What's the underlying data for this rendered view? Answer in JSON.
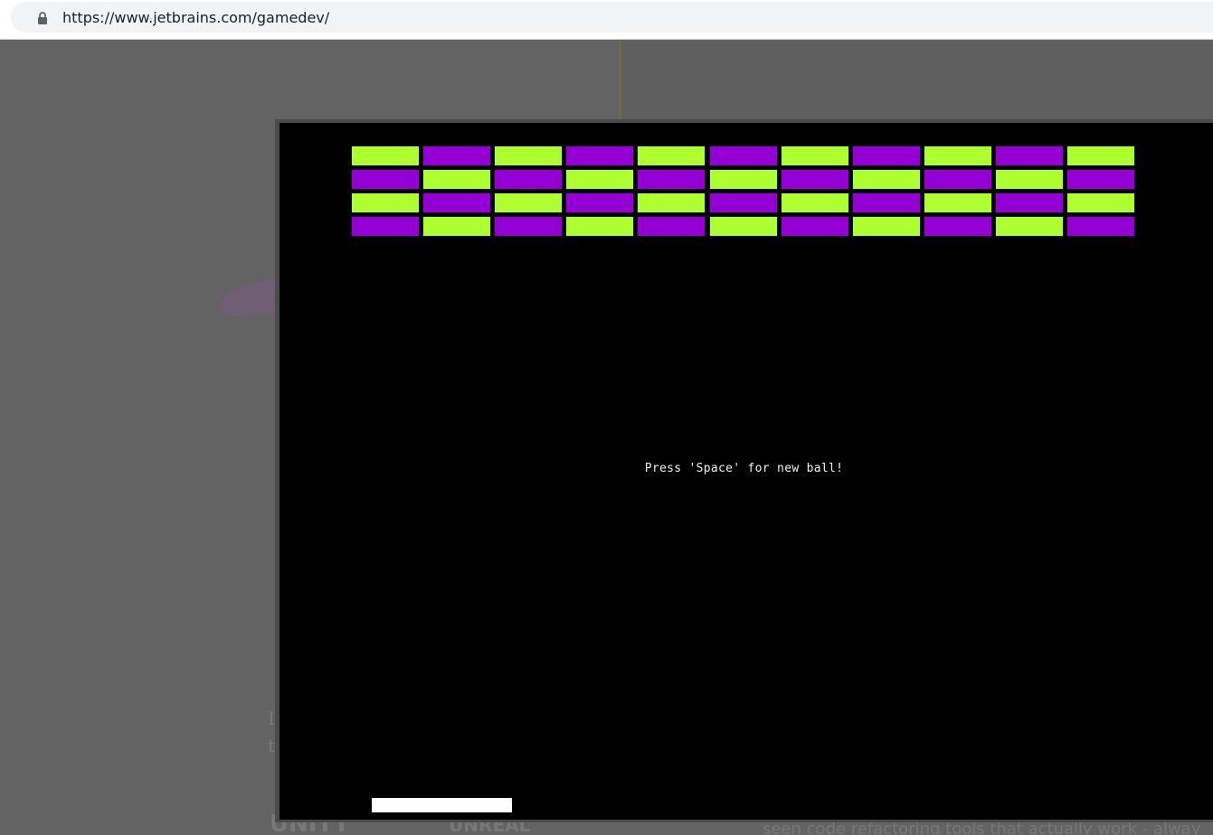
{
  "browser": {
    "url": "https://www.jetbrains.com/gamedev/"
  },
  "background_page": {
    "letters": [
      "I",
      "t"
    ],
    "footer_logos": [
      "UNITY",
      "UNREAL"
    ],
    "footer_text": "seen code refactoring tools that actually work - alway"
  },
  "game": {
    "message": "Press 'Space' for new ball!",
    "colors": {
      "green": "#adff2f",
      "purple": "#9400d3",
      "paddle": "#ffffff",
      "background": "#000000"
    },
    "bricks": {
      "rows": [
        [
          "green",
          "purple",
          "green",
          "purple",
          "green",
          "purple",
          "green",
          "purple",
          "green",
          "purple",
          "green"
        ],
        [
          "purple",
          "green",
          "purple",
          "green",
          "purple",
          "green",
          "purple",
          "green",
          "purple",
          "green",
          "purple"
        ],
        [
          "green",
          "purple",
          "green",
          "purple",
          "green",
          "purple",
          "green",
          "purple",
          "green",
          "purple",
          "green"
        ],
        [
          "purple",
          "green",
          "purple",
          "green",
          "purple",
          "green",
          "purple",
          "green",
          "purple",
          "green",
          "purple"
        ]
      ]
    }
  }
}
